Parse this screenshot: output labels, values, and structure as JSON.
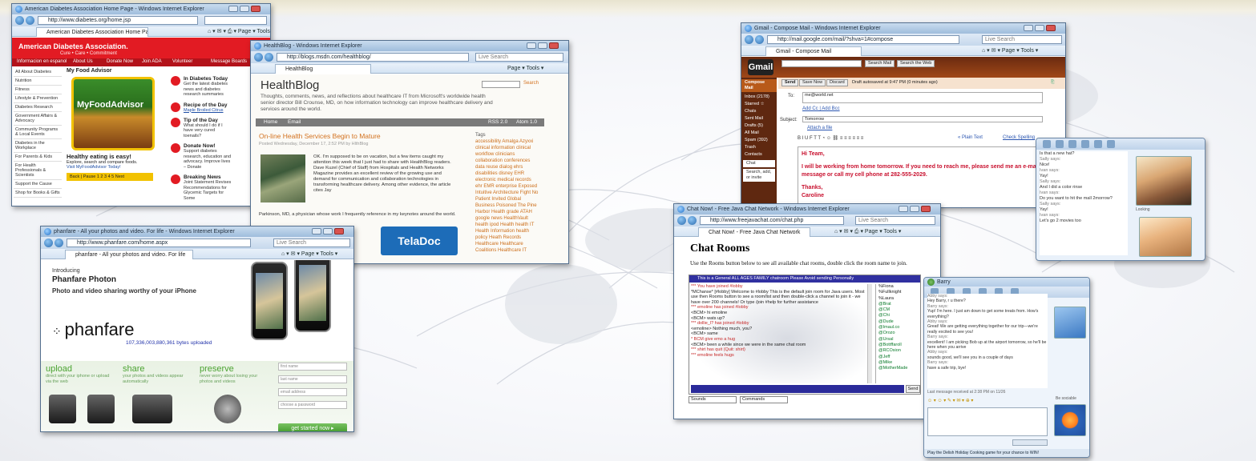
{
  "windows": {
    "ada": {
      "title": "American Diabetes Association Home Page - Windows Internet Explorer",
      "url": "http://www.diabetes.org/home.jsp",
      "tab": "American Diabetes Association Home Page",
      "logo": "American Diabetes Association.",
      "tagline": "Cure • Care • Commitment",
      "nav": [
        "Informacion en espanol",
        "About Us",
        "Donate Now",
        "Join ADA",
        "Volunteer",
        "Message Boards"
      ],
      "sidebar": [
        "All About Diabetes",
        "Nutrition",
        "Fitness",
        "Lifestyle & Prevention",
        "Diabetes Research",
        "Government Affairs & Advocacy",
        "Community Programs & Local Events",
        "Diabetes in the Workplace",
        "For Parents & Kids",
        "For Health Professionals & Scientists",
        "Support the Cause",
        "Shop for Books & Gifts"
      ],
      "food_advisor_heading": "My Food Advisor",
      "food_advisor_badge": "MyFoodAdvisor",
      "healthy_heading": "Healthy eating is easy!",
      "healthy_text": "Explore, search and compare foods.",
      "healthy_link": "Visit MyFoodAdvisor Today!",
      "pager": "Back | Pause   1 2 3 4 5   Next",
      "right_items": [
        {
          "heading": "In Diabetes Today",
          "text": "Get the latest diabetes news and diabetes research summaries"
        },
        {
          "heading": "Recipe of the Day",
          "text": "Maple Broiled Citrus"
        },
        {
          "heading": "Tip of the Day",
          "text": "What should I do if I have very cured toenails?"
        },
        {
          "heading": "Donate Now!",
          "text": "Support diabetes research, education and advocacy. Improve lives – Donate"
        },
        {
          "heading": "Breaking News",
          "text": "Joint Statement Revises Recommendations for Glycemic Targets for Some"
        }
      ]
    },
    "healthblog": {
      "title": "HealthBlog - Windows Internet Explorer",
      "url": "http://blogs.msdn.com/healthblog/",
      "search_placeholder": "Live Search",
      "tab": "HealthBlog",
      "tools": "Page ▾   Tools ▾",
      "heading": "HealthBlog",
      "description": "Thoughts, comments, news, and reflections about healthcare IT from Microsoft's worldwide health senior director Bill Crounse, MD, on how information technology can improve healthcare delivery and services around the world.",
      "search_label": "Search",
      "nav": [
        "Home",
        "Email",
        "RSS 2.0",
        "Atom 1.0"
      ],
      "post_title": "On-line Health Services Begin to Mature",
      "post_meta": "Posted Wednesday, December 17, 2:52 PM by HlthBlog",
      "post_text": "OK.  I'm supposed to be on vacation, but a few items caught my attention this week that I just had to share with HealthBlog readers. Dave Kuzel (Chief of Staff) from Hospitals and Health Networks Magazine provides an excellent review of the growing use and demand for communication and collaboration technologies in transforming healthcare delivery. Among other evidence, the article cites Jay",
      "post_text2": "Parkinson, MD, a physician whose work I frequently reference in my keynotes around the world.",
      "tags_heading": "Tags",
      "tags": "accessibility Amalga Azyxxi clinical information clinical workflow clinicians collaboration conferences data reuse dialog ehrs disabilities disney EHR electronic medical records ehr EMR enterprise Exposed Intuitive Architecture Fight No Patient Invited Global Business Poisoned The Pine Harbor Health grade ATAH google news HealthVault health ipod Health health IT Health Information health policy Heath Records Healthcare Healthcare Coalitions Healthcare IT",
      "ad_text": "TelaDoc"
    },
    "phanfare": {
      "title": "phanfare - All your photos and video. For life - Windows Internet Explorer",
      "url": "http://www.phanfare.com/home.aspx",
      "search_placeholder": "Live Search",
      "tab": "phanfare - All your photos and video. For life",
      "intro": "Introducing",
      "brand": "Phanfare Photon",
      "subline": "Photo and video sharing worthy of your iPhone",
      "logo_text": "phanfare",
      "count": "107,336,003,880,361 bytes uploaded",
      "columns": [
        {
          "heading": "upload",
          "text": "direct with your iphone or upload via the web"
        },
        {
          "heading": "share",
          "text": "your photos and videos appear automatically"
        },
        {
          "heading": "preserve",
          "text": "never worry about losing your photos and videos"
        }
      ],
      "form_fields": [
        "first name",
        "last name",
        "email address",
        "choose a password"
      ],
      "cta": "get started now ▸"
    },
    "gmail": {
      "title": "Gmail - Compose Mail - Windows Internet Explorer",
      "url": "http://mail.google.com/mail/?shva=1#compose",
      "search_placeholder": "Live Search",
      "tab": "Gmail - Compose Mail",
      "logo": "Gmail",
      "search_mail": "Search Mail",
      "search_web": "Search the Web",
      "compose": "Compose Mail",
      "folders": [
        "Inbox (2178)",
        "Starred ☆",
        "Chats",
        "Sent Mail",
        "Drafts (5)",
        "All Mail",
        "Spam (392)",
        "Trash",
        "Contacts"
      ],
      "chat_label": "Chat",
      "chat_search": "Search, add, or invite",
      "send": "Send",
      "save_now": "Save Now",
      "discard": "Discard",
      "draft_status": "Draft autosaved at 9:47 PM (0 minutes ago)",
      "to_label": "To:",
      "to_value": "me@world.net",
      "add_cc": "Add Cc | Add Bcc",
      "subject_label": "Subject:",
      "subject_value": "Tomorrow",
      "attach": "Attach a file",
      "plain_text": "« Plain Text",
      "check_spelling": "Check Spelling",
      "body_greeting": "Hi Team,",
      "body_text": "I will be working from home tomorrow. If you need to reach me, please send me an e-mail message or call my cell phone at 282-555-2029.",
      "body_sign": "Thanks,",
      "body_name": "Caroline"
    },
    "im1": {
      "conversation": [
        {
          "s": "Is that a new hat?",
          "t": ""
        },
        {
          "s": "Sally says:",
          "t": "Nice!"
        },
        {
          "s": "Ivan says:",
          "t": "Yay!"
        },
        {
          "s": "Sally says:",
          "t": "And I did a color rinse"
        },
        {
          "s": "Ivan says:",
          "t": "Do you want to hit the mall 2morrow?"
        },
        {
          "s": "Sally says:",
          "t": "Yay!"
        },
        {
          "s": "Ivan says:",
          "t": "Let's go 2 movies too"
        }
      ],
      "status": "Looking"
    },
    "chat": {
      "title": "Chat Now! - Free Java Chat Network - Windows Internet Explorer",
      "url": "http://www.freejavachat.com/chat.php",
      "search_placeholder": "Live Search",
      "tab": "Chat Now! - Free Java Chat Network",
      "heading": "Chat Rooms",
      "intro": "Use the Rooms button below to see all available chat rooms, double click the room name to join.",
      "banner": "This is a General ALL AGES FAMILY chatroom Please Avoid sending Personally",
      "log": [
        {
          "c": "sys",
          "t": "*** You have joined #lobby"
        },
        {
          "c": "",
          "t": "*MChanse* [#lobby] Welcome to #lobby This is the default join room for Java users. Most use then Rooms button to see a room/list and then double-click a channel to join it - we have over 200 channels! Or type /join #help for further assistance"
        },
        {
          "c": "sys",
          "t": "*** emoline has joined #lobby"
        },
        {
          "c": "",
          "t": "<BCM> hi emoline"
        },
        {
          "c": "",
          "t": "<BCM> wats up?"
        },
        {
          "c": "sys",
          "t": "*** dollie_l? has joined #lobby"
        },
        {
          "c": "",
          "t": "<emoline> Nothing much, you?"
        },
        {
          "c": "",
          "t": "<BCM> same"
        },
        {
          "c": "sys",
          "t": "* BCM give emo a hug"
        },
        {
          "c": "",
          "t": "<BCM> been a while since we were in the same chat room"
        },
        {
          "c": "sys",
          "t": "*** shirt has quit (Quit: shirt)"
        },
        {
          "c": "sys",
          "t": "*** emoline feels hugs"
        }
      ],
      "users": [
        "%Fiona",
        "%Fullknight",
        "%Laura",
        "@Brat",
        "@CM",
        "@Chi",
        "@Dude",
        "@Imaul.co",
        "@Orozo",
        "@Ursal",
        "@Bottffaroll",
        "@RCOsion",
        "@Jeff",
        "@Mike",
        "@MotherMade"
      ],
      "send": "Send",
      "sounds": "Sounds",
      "commands": "Commands"
    },
    "im2": {
      "title": "Barry",
      "conversation": [
        {
          "s": "Abby says:",
          "t": "Hey Barry, r u there?"
        },
        {
          "s": "Barry says:",
          "t": "Yup! I'm here. I just am down to get some treats from. How's everything?"
        },
        {
          "s": "Abby says:",
          "t": "Great! We are getting everything together for our trip—we're really excited to see you!"
        },
        {
          "s": "Barry says:",
          "t": "excellent! I am picking Bob up at the airport tomorrow, so he'll be here when you arrive"
        },
        {
          "s": "Abby says:",
          "t": "sounds good, we'll see you in a couple of days"
        },
        {
          "s": "Barry says:",
          "t": "have a safe trip, bye!"
        }
      ],
      "last_message": "Last message received at 2:38 PM on 11/26",
      "footer": "Play the Delish Holiday Cooking game for your chance to WIN!",
      "status": "Be sociable"
    }
  }
}
